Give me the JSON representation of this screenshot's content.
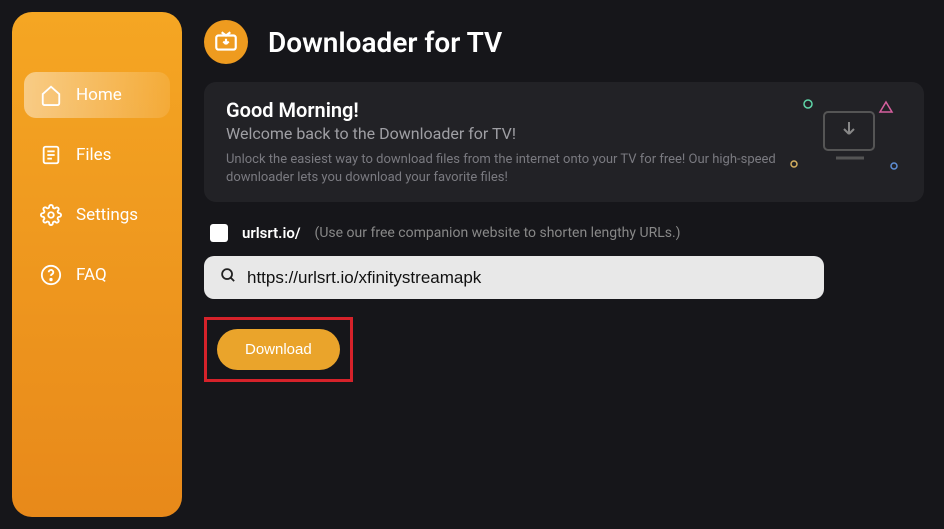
{
  "app": {
    "title": "Downloader for TV"
  },
  "sidebar": {
    "items": [
      {
        "label": "Home"
      },
      {
        "label": "Files"
      },
      {
        "label": "Settings"
      },
      {
        "label": "FAQ"
      }
    ]
  },
  "welcome": {
    "greeting": "Good Morning!",
    "subtitle": "Welcome back to the Downloader for TV!",
    "description": "Unlock the easiest way to download files from the internet onto your TV for free! Our high-speed downloader lets you download your favorite files!"
  },
  "url_shortener": {
    "prefix": "urlsrt.io/",
    "hint": "(Use our free companion website to shorten lengthy URLs.)"
  },
  "search": {
    "value": "https://urlsrt.io/xfinitystreamapk"
  },
  "buttons": {
    "download": "Download"
  }
}
